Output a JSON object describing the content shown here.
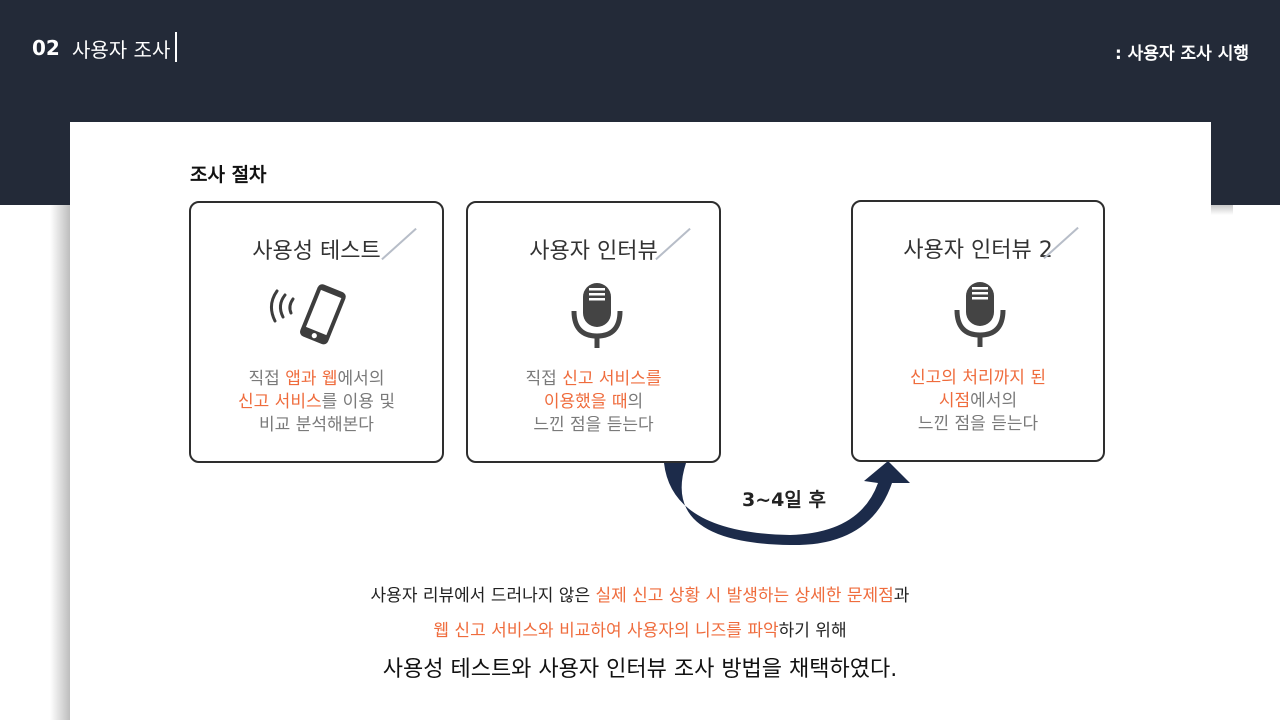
{
  "header": {
    "section_number": "02",
    "section_title": "사용자 조사",
    "subtitle": ": 사용자 조사 시행"
  },
  "heading": "조사 절차",
  "cards": [
    {
      "title": "사용성 테스트",
      "icon": "smartphone-vibrate-icon",
      "desc": [
        [
          {
            "t": "직접 "
          },
          {
            "t": "앱과 웹",
            "hl": true
          },
          {
            "t": "에서의"
          }
        ],
        [
          {
            "t": "신고 서비스",
            "hl": true
          },
          {
            "t": "를 이용 및"
          }
        ],
        [
          {
            "t": "비교 분석해본다"
          }
        ]
      ]
    },
    {
      "title": "사용자 인터뷰",
      "icon": "microphone-icon",
      "desc": [
        [
          {
            "t": "직접 "
          },
          {
            "t": "신고 서비스를",
            "hl": true
          }
        ],
        [
          {
            "t": "이용했을 때",
            "hl": true
          },
          {
            "t": "의"
          }
        ],
        [
          {
            "t": "느낀 점을 듣는다"
          }
        ]
      ]
    },
    {
      "title": "사용자 인터뷰 2",
      "icon": "microphone-icon",
      "desc": [
        [
          {
            "t": "신고의 처리까지 된",
            "hl": true
          }
        ],
        [
          {
            "t": "시점",
            "hl": true
          },
          {
            "t": "에서의"
          }
        ],
        [
          {
            "t": "느낀 점을 듣는다"
          }
        ]
      ]
    }
  ],
  "arrow_label": "3~4일 후",
  "summary": [
    [
      {
        "t": "사용자 리뷰에서 드러나지 않은 "
      },
      {
        "t": "실제 신고 상황 시 발생하는 상세한 문제점",
        "hl": true
      },
      {
        "t": "과"
      }
    ],
    [
      {
        "t": "웹 신고 서비스와 비교하여 사용자의 니즈를 파악",
        "hl": true
      },
      {
        "t": "하기 위해"
      }
    ],
    [
      {
        "t": "사용성 테스트와 사용자 인터뷰 조사 방법을 채택하였다."
      }
    ]
  ],
  "colors": {
    "header_bg": "#232a38",
    "accent": "#ef6c3d",
    "arrow": "#1c2b4a",
    "text_gray": "#7a7a7a"
  }
}
